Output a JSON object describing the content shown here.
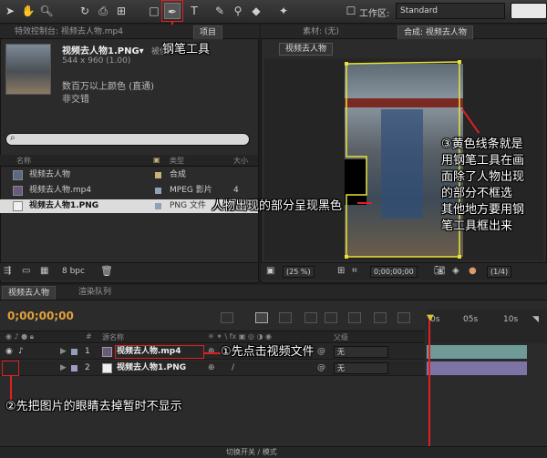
{
  "toolbar": {
    "workspace_label": "工作区:",
    "workspace_value": "Standard",
    "tools": [
      "selection-tool",
      "hand-tool",
      "zoom-tool",
      "rotate-tool",
      "camera-tool",
      "pan-behind-tool",
      "rectangle-tool",
      "pen-tool",
      "type-tool",
      "brush-tool",
      "clone-stamp-tool",
      "eraser-tool",
      "puppet-tool"
    ]
  },
  "project_panel": {
    "tab_effects": "特效控制台: 视频去人物.mp4",
    "tab_project": "项目",
    "file_name": "视频去人物1.PNG▾",
    "file_used": "被使",
    "file_dims": "544 x 960 (1.00)",
    "file_colors": "数百万以上颜色 (直通)",
    "file_interlace": "非交错",
    "columns": [
      "名称",
      "类型",
      "大小"
    ],
    "items": [
      {
        "name": "视频去人物",
        "type": "合成",
        "color": "#c8b27a",
        "selected": false
      },
      {
        "name": "视频去人物.mp4",
        "type": "MPEG 影片",
        "size": "4",
        "color": "#8fa0b8",
        "selected": false
      },
      {
        "name": "视频去人物1.PNG",
        "type": "PNG 文件",
        "color": "#8fa0b8",
        "selected": true
      }
    ],
    "bpc": "8 bpc"
  },
  "viewer": {
    "tab_footage": "素材: (无)",
    "tab_comp": "合成: 视频去人物",
    "comp_button": "视频去人物",
    "zoom": "(25 %)",
    "timecode": "0;00;00;00",
    "resolution": "(1/4)"
  },
  "timeline": {
    "tab_comp": "视频去人物",
    "tab_render": "渲染队列",
    "timecode": "0;00;00;00",
    "col_source": "源名称",
    "col_parent": "父级",
    "ruler_labels": [
      "0s",
      "05s",
      "10s"
    ],
    "layers": [
      {
        "num": "1",
        "name": "视频去人物.mp4",
        "parent": "无",
        "label_color": "#8fa0b8"
      },
      {
        "num": "2",
        "name": "视频去人物1.PNG",
        "parent": "无",
        "label_color": "#a49ac8"
      }
    ],
    "footer_toggle": "切换开关 / 模式"
  },
  "annotations": {
    "pen_tool": "钢笔工具",
    "black_area": "人物出现的部分呈现黑色",
    "step1": "①先点击视频文件",
    "step2": "②先把图片的眼睛去掉暂时不显示",
    "step3_lines": [
      "③黄色线条就是",
      "用钢笔工具在画",
      "面除了人物出现",
      "的部分不框选",
      "其他地方要用钢",
      "笔工具框出来"
    ]
  },
  "colors": {
    "annotation_red": "#e02020",
    "mask_yellow": "#e8e23a",
    "timecode_orange": "#e0a23a",
    "playhead_red": "#e02020"
  }
}
